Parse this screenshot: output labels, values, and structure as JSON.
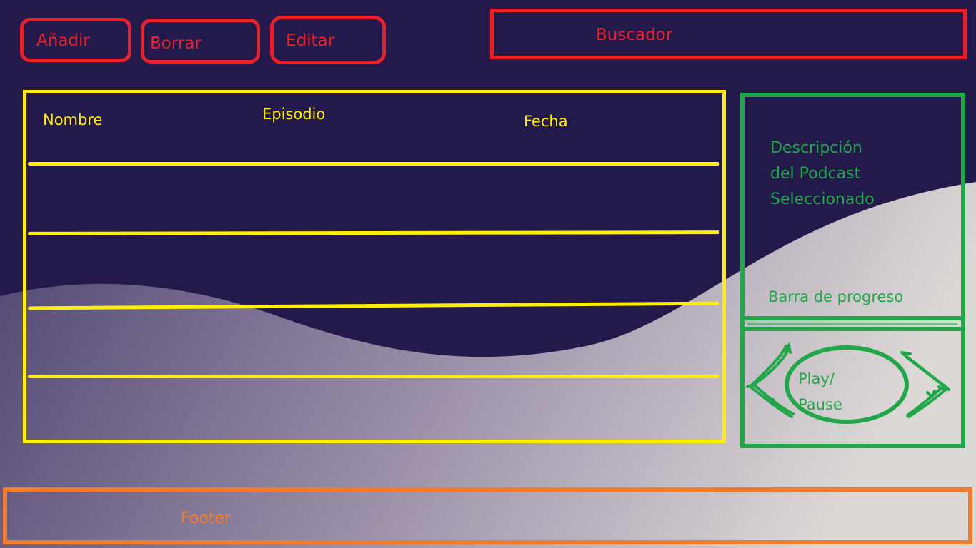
{
  "colors": {
    "background": "#24194b",
    "toolbar_outline": "#e8202a",
    "table_outline": "#ffee00",
    "player_outline": "#21a74a",
    "footer_outline": "#f47b2a"
  },
  "toolbar": {
    "add_label": "Añadir",
    "delete_label": "Borrar",
    "edit_label": "Editar",
    "search_label": "Buscador"
  },
  "table": {
    "columns": [
      "Nombre",
      "Episodio",
      "Fecha"
    ],
    "rows": [
      {
        "name": "",
        "episode": "",
        "date": ""
      },
      {
        "name": "",
        "episode": "",
        "date": ""
      },
      {
        "name": "",
        "episode": "",
        "date": ""
      },
      {
        "name": "",
        "episode": "",
        "date": ""
      }
    ]
  },
  "player": {
    "description_lines": [
      "Descripción",
      "del Podcast",
      "Seleccionado"
    ],
    "progress_label": "Barra de progreso",
    "play_pause_lines": [
      "Play/",
      "Pause"
    ],
    "prev_icon": "rewind-icon",
    "next_icon": "forward-icon"
  },
  "footer": {
    "label": "Footer"
  }
}
